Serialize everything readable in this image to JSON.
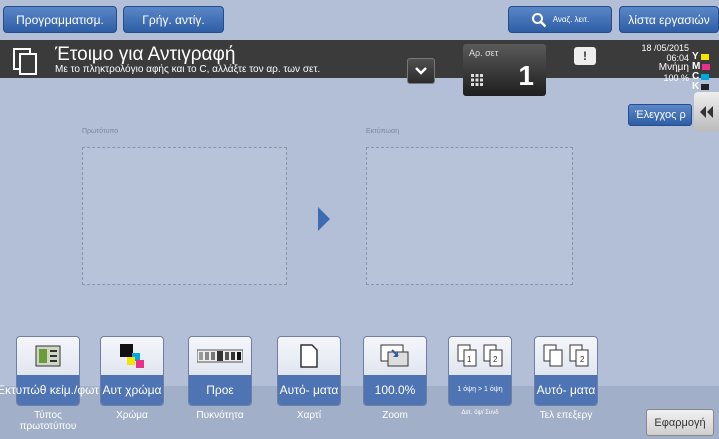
{
  "topbar": {
    "programs": "Προγραμματισμ.",
    "quick_copy": "Γρήγ. αντίγ.",
    "search": "Αναζ. λειτ.",
    "job_list": "λίστα εργασιών"
  },
  "status": {
    "title": "Έτοιμο για Αντιγραφή",
    "message": "Με το πληκτρολόγιο αφής και το C, αλλάξτε τον αρ. των σετ.",
    "sets_label": "Αρ. σετ",
    "sets_value": "1",
    "date": "18 /05/2015",
    "time": "06:04",
    "memory_label": "Μνήμη",
    "memory_value": "100 %",
    "check_button": "Έλεγχος ρ"
  },
  "toner": [
    {
      "letter": "Y",
      "color": "#f2e600"
    },
    {
      "letter": "M",
      "color": "#e8308a"
    },
    {
      "letter": "C",
      "color": "#00a8e0"
    },
    {
      "letter": "K",
      "color": "#222222"
    }
  ],
  "preview": {
    "original_label": "Πρωτότυπο",
    "output_label": "Εκτύπωση"
  },
  "functions": [
    {
      "value": "Εκτυπώθ κείμ./φωτ",
      "label": "Τύπος πρωτοτύπου",
      "icon": "original-type-icon"
    },
    {
      "value": "Αυτ χρώμα",
      "label": "Χρώμα",
      "icon": "color-icon"
    },
    {
      "value": "Προε",
      "label": "Πυκνότητα",
      "icon": "density-icon"
    },
    {
      "value": "Αυτό- ματα",
      "label": "Χαρτί",
      "icon": "paper-icon"
    },
    {
      "value": "100.0%",
      "label": "Zoom",
      "icon": "zoom-icon"
    },
    {
      "value": "1 όψη > 1 όψη",
      "label": "Διπ. όψ/ Συνδ",
      "icon": "duplex-icon"
    },
    {
      "value": "Αυτό- ματα",
      "label": "Τελ επεξεργ",
      "icon": "finishing-icon"
    }
  ],
  "apply": "Εφαρμογή",
  "colors": {
    "accent": "#3d6cb0",
    "background": "#b3bfd6",
    "status_bar": "#3b3b3b"
  }
}
